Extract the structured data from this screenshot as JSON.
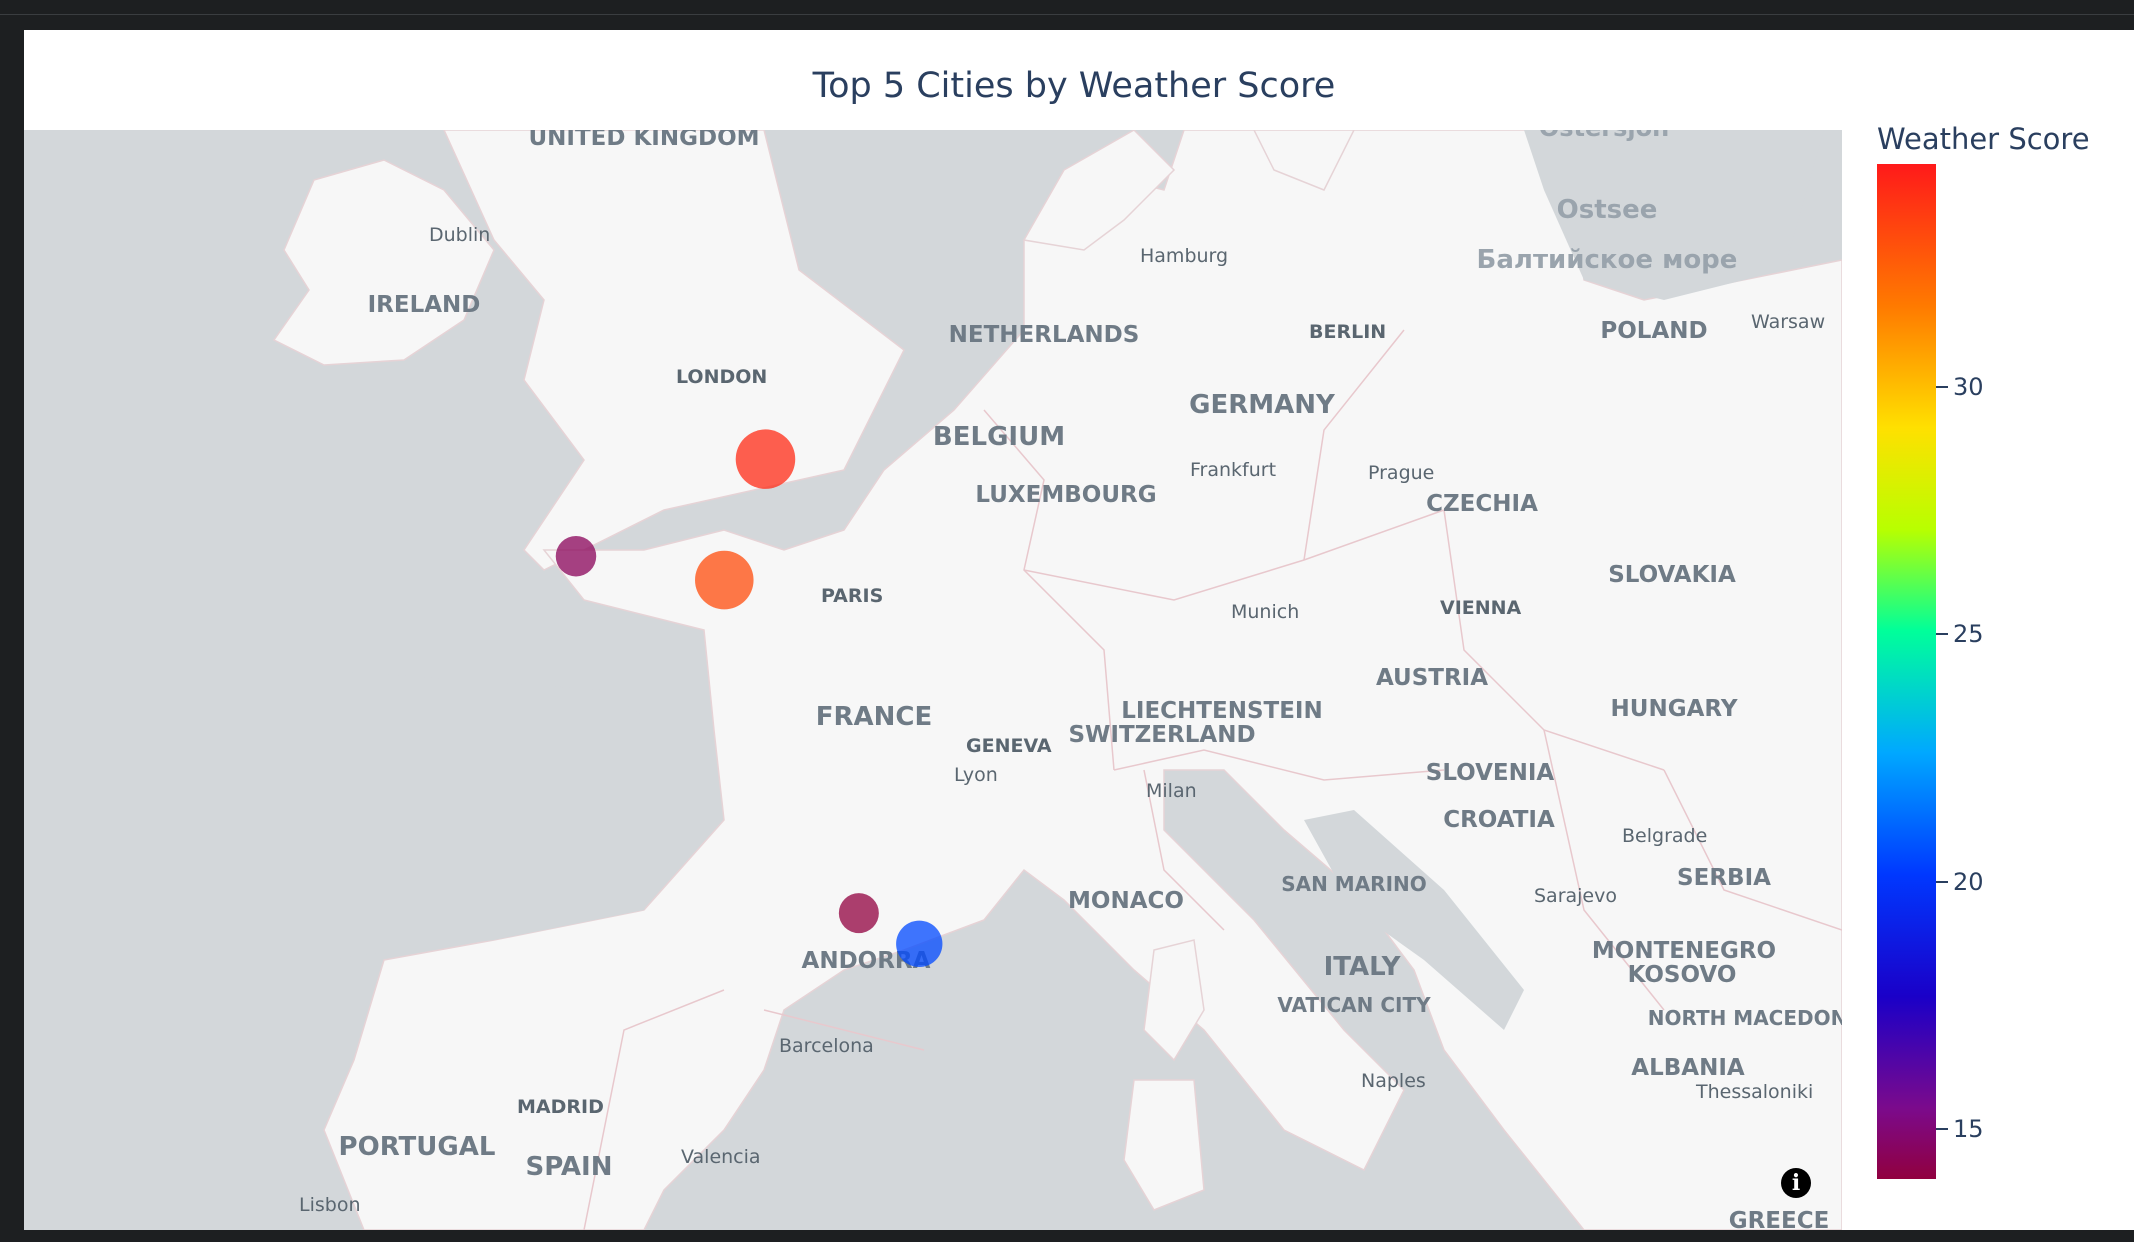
{
  "chart_data": {
    "type": "scatter",
    "title": "Top 5 Cities by Weather Score",
    "colorbar": {
      "title": "Weather Score",
      "ticks": [
        "15",
        "20",
        "25",
        "30"
      ],
      "range": [
        14,
        34.5
      ]
    },
    "colorscale": "rainbow",
    "points": [
      {
        "lat": 50.6,
        "lon": 3.1,
        "score": 34,
        "marker": "score-marker-1"
      },
      {
        "lat": 48.85,
        "lon": 2.35,
        "score": 33,
        "marker": "score-marker-2"
      },
      {
        "lat": 49.2,
        "lon": -0.35,
        "score": 14.5,
        "marker": "score-marker-3"
      },
      {
        "lat": 43.7,
        "lon": 4.8,
        "score": 14,
        "marker": "score-marker-4"
      },
      {
        "lat": 43.2,
        "lon": 5.9,
        "score": 20.5,
        "marker": "score-marker-5"
      }
    ],
    "basemap": "light map"
  },
  "map_labels": {
    "countries": [
      "UNITED KINGDOM",
      "IRELAND",
      "NETHERLANDS",
      "BELGIUM",
      "LUXEMBOURG",
      "GERMANY",
      "POLAND",
      "CZECHIA",
      "SLOVAKIA",
      "AUSTRIA",
      "HUNGARY",
      "FRANCE",
      "SWITZERLAND",
      "LIECHTENSTEIN",
      "SLOVENIA",
      "CROATIA",
      "SERBIA",
      "MONACO",
      "SAN MARINO",
      "ITALY",
      "VATICAN CITY",
      "ANDORRA",
      "MONTENEGRO",
      "KOSOVO",
      "NORTH MACEDONIA",
      "ALBANIA",
      "PORTUGAL",
      "SPAIN",
      "GREECE"
    ],
    "cities": [
      "Dublin",
      "LONDON",
      "Hamburg",
      "BERLIN",
      "Warsaw",
      "Frankfurt",
      "Prague",
      "PARIS",
      "Munich",
      "VIENNA",
      "GENEVA",
      "Lyon",
      "Milan",
      "Belgrade",
      "Sarajevo",
      "Naples",
      "Barcelona",
      "MADRID",
      "Valencia",
      "Lisbon",
      "Thessaloniki"
    ],
    "seas": [
      "Ostersjon",
      "Ostsee",
      "Балтийское море"
    ]
  },
  "info_icon": "i"
}
